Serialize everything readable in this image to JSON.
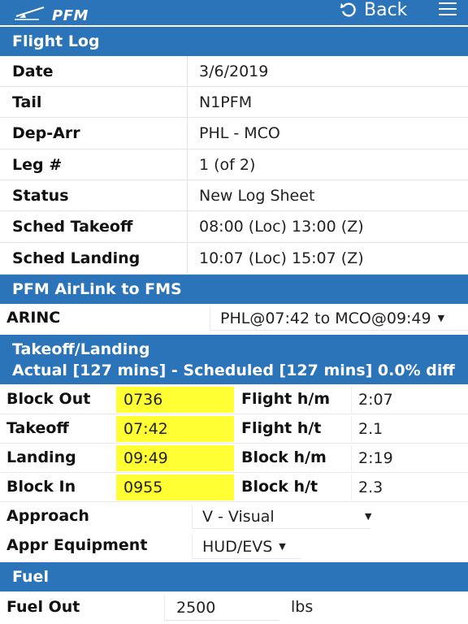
{
  "header": {
    "logo_text": "PFM",
    "back_label": "Back"
  },
  "flight_log": {
    "title": "Flight Log",
    "rows": [
      {
        "label": "Date",
        "value": "3/6/2019"
      },
      {
        "label": "Tail",
        "value": "N1PFM"
      },
      {
        "label": "Dep-Arr",
        "value": "PHL - MCO"
      },
      {
        "label": "Leg #",
        "value": "1 (of 2)"
      },
      {
        "label": "Status",
        "value": "New Log Sheet"
      },
      {
        "label": "Sched Takeoff",
        "value": "08:00 (Loc) 13:00 (Z)"
      },
      {
        "label": "Sched Landing",
        "value": "10:07 (Loc) 15:07 (Z)"
      }
    ]
  },
  "airlink": {
    "title": "PFM AirLink to FMS",
    "arinc_label": "ARINC",
    "arinc_value": "PHL@07:42 to MCO@09:49"
  },
  "takeoff_landing": {
    "title": "Takeoff/Landing",
    "subtitle": "Actual [127 mins] - Scheduled [127 mins] 0.0% diff",
    "rows": [
      {
        "label": "Block Out",
        "value": "0736",
        "label2": "Flight h/m",
        "value2": "2:07"
      },
      {
        "label": "Takeoff",
        "value": "07:42",
        "label2": "Flight h/t",
        "value2": "2.1"
      },
      {
        "label": "Landing",
        "value": "09:49",
        "label2": "Block h/m",
        "value2": "2:19"
      },
      {
        "label": "Block In",
        "value": "0955",
        "label2": "Block h/t",
        "value2": "2.3"
      }
    ],
    "approach_label": "Approach",
    "approach_value": "V - Visual",
    "appr_equipment_label": "Appr Equipment",
    "appr_equipment_value": "HUD/EVS"
  },
  "fuel": {
    "title": "Fuel",
    "fuel_out_label": "Fuel Out",
    "fuel_out_value": "2500",
    "fuel_out_unit": "lbs"
  },
  "colors": {
    "header_blue": "#2b74ba",
    "highlight_yellow": "#ffff33"
  }
}
